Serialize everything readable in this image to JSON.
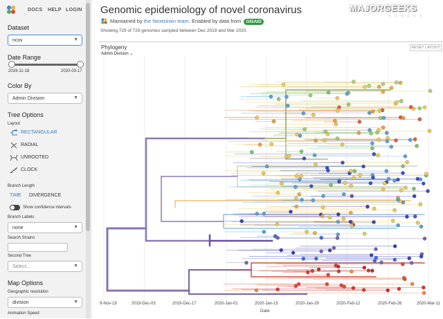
{
  "nav": {
    "docs": "DOCS",
    "help": "HELP",
    "login": "LOGIN"
  },
  "sidebar": {
    "dataset": {
      "title": "Dataset",
      "value": "ncov"
    },
    "date_range": {
      "title": "Date Range",
      "start": "2019-11-18",
      "end": "2020-03-17"
    },
    "color_by": {
      "title": "Color By",
      "value": "Admin Division"
    },
    "tree_options": {
      "title": "Tree Options",
      "layout_label": "Layout",
      "layouts": [
        "RECTANGULAR",
        "RADIAL",
        "UNROOTED",
        "CLOCK"
      ],
      "selected_layout": "RECTANGULAR",
      "branch_length_label": "Branch Length",
      "branch_length_options": [
        "TIME",
        "DIVERGENCE"
      ],
      "confidence_label": "Show confidence intervals",
      "branch_labels_label": "Branch Labels",
      "branch_labels_value": "none",
      "search_label": "Search Strains",
      "second_tree_label": "Second Tree",
      "second_tree_value": "Select..."
    },
    "map_options": {
      "title": "Map Options",
      "geo_label": "Geographic resolution",
      "geo_value": "division",
      "animation_label": "Animation Speed"
    }
  },
  "header": {
    "title": "Genomic epidemiology of novel coronavirus",
    "maintained_prefix": "Maintained by",
    "team_link": "the Nextstrain team",
    "enabled_text": ". Enabled by data from",
    "gisaid": "GISAID",
    "showing": "Showing 729 of 729 genomes sampled between Dec 2019 and Mar 2020."
  },
  "panel": {
    "title": "Phylogeny",
    "color_label": "Admin Division",
    "reset_button": "RESET LAYOUT",
    "x_axis_label": "Date",
    "x_ticks": [
      "9-Nov-19",
      "2019-Dec-03",
      "2019-Dec-17",
      "2020-Jan-01",
      "2020-Jan-15",
      "2020-Jan-29",
      "2020-Feb-12",
      "2020-Feb-26",
      "2020-Mar-11"
    ]
  },
  "watermark": {
    "text": "MAJORGEEKS",
    "stars": "★ ★ ★ ★ ★ ★"
  },
  "colors": {
    "accent": "#3a7ab8",
    "purple": "#6a4fa3",
    "green": "#9ab86a",
    "red": "#d63a2f",
    "gisaid": "#2e9a3c"
  }
}
